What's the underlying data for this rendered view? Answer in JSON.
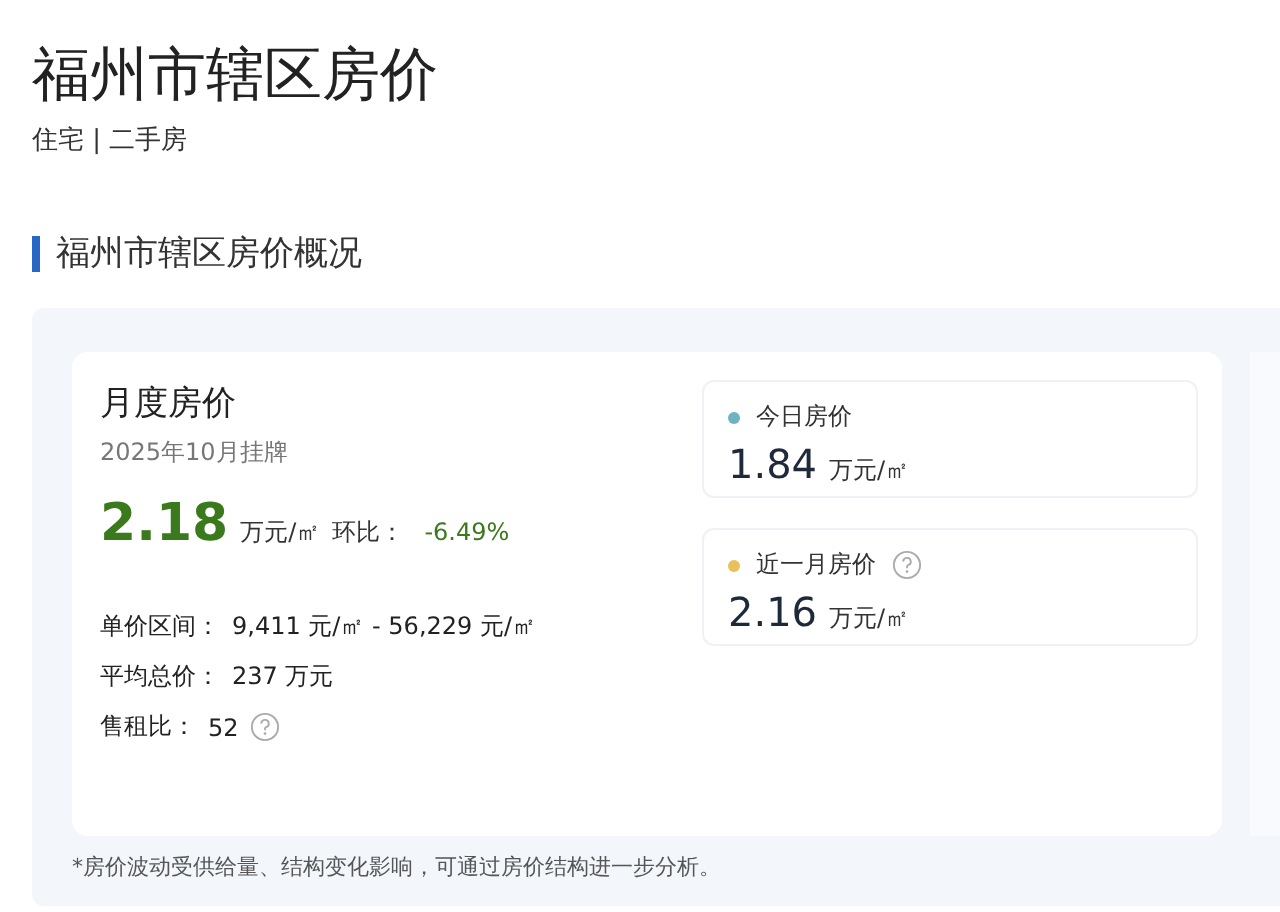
{
  "page": {
    "title": "福州市辖区房价",
    "subtitle": "住宅 | 二手房"
  },
  "section": {
    "title": "福州市辖区房价概况"
  },
  "monthly": {
    "title": "月度房价",
    "date": "2025年10月挂牌",
    "price": "2.18",
    "unit": "万元/㎡",
    "change_label": "环比：",
    "change": "-6.49%",
    "stats": [
      {
        "label": "单价区间：",
        "value": "9,411 元/㎡ - 56,229 元/㎡",
        "help": false
      },
      {
        "label": "平均总价：",
        "value": "237 万元",
        "help": false
      },
      {
        "label": "售租比：",
        "value": "52",
        "help": true
      }
    ]
  },
  "indicators": [
    {
      "label": "今日房价",
      "color": "#6fb3c0",
      "help": false,
      "value": "1.84",
      "unit": "万元/㎡"
    },
    {
      "label": "近一月房价",
      "color": "#e8c15a",
      "help": true,
      "value": "2.16",
      "unit": "万元/㎡"
    }
  ],
  "footnote": "*房价波动受供给量、结构变化影响，可通过房价结构进一步分析。"
}
